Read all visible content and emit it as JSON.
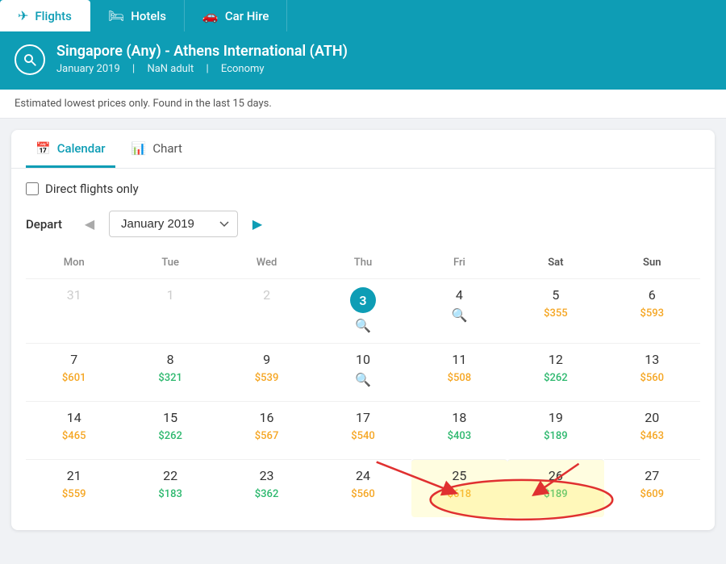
{
  "tabs": [
    {
      "id": "flights",
      "label": "Flights",
      "icon": "✈",
      "active": true
    },
    {
      "id": "hotels",
      "label": "Hotels",
      "icon": "🛏",
      "active": false
    },
    {
      "id": "carhire",
      "label": "Car Hire",
      "icon": "🚗",
      "active": false
    }
  ],
  "search": {
    "route": "Singapore (Any) - Athens International (ATH)",
    "month": "January 2019",
    "adults": "NaN adult",
    "class": "Economy"
  },
  "notice": "Estimated lowest prices only. Found in the last 15 days.",
  "view_tabs": [
    {
      "id": "calendar",
      "label": "Calendar",
      "icon": "📅",
      "active": true
    },
    {
      "id": "chart",
      "label": "Chart",
      "icon": "📊",
      "active": false
    }
  ],
  "calendar": {
    "direct_flights_label": "Direct flights only",
    "depart_label": "Depart",
    "month_display": "January 2019",
    "day_headers": [
      "Mon",
      "Tue",
      "Wed",
      "Thu",
      "Fri",
      "Sat",
      "Sun"
    ],
    "weeks": [
      [
        {
          "num": "31",
          "empty": true,
          "price": "",
          "price_color": ""
        },
        {
          "num": "1",
          "empty": true,
          "price": "",
          "price_color": ""
        },
        {
          "num": "2",
          "empty": true,
          "price": "",
          "price_color": ""
        },
        {
          "num": "3",
          "today": true,
          "price": "",
          "price_color": "",
          "search": true
        },
        {
          "num": "4",
          "price": "",
          "price_color": "",
          "search": true
        },
        {
          "num": "5",
          "price": "$355",
          "price_color": "orange"
        },
        {
          "num": "6",
          "price": "$593",
          "price_color": "orange"
        }
      ],
      [
        {
          "num": "7",
          "price": "$601",
          "price_color": "orange"
        },
        {
          "num": "8",
          "price": "$321",
          "price_color": "green"
        },
        {
          "num": "9",
          "price": "$539",
          "price_color": "orange"
        },
        {
          "num": "10",
          "price": "",
          "price_color": "",
          "search": true
        },
        {
          "num": "11",
          "price": "$508",
          "price_color": "orange"
        },
        {
          "num": "12",
          "price": "$262",
          "price_color": "green"
        },
        {
          "num": "13",
          "price": "$560",
          "price_color": "orange"
        }
      ],
      [
        {
          "num": "14",
          "price": "$465",
          "price_color": "orange"
        },
        {
          "num": "15",
          "price": "$262",
          "price_color": "green"
        },
        {
          "num": "16",
          "price": "$567",
          "price_color": "orange"
        },
        {
          "num": "17",
          "price": "$540",
          "price_color": "orange"
        },
        {
          "num": "18",
          "price": "$403",
          "price_color": "green"
        },
        {
          "num": "19",
          "price": "$189",
          "price_color": "green"
        },
        {
          "num": "20",
          "price": "$463",
          "price_color": "orange"
        }
      ],
      [
        {
          "num": "21",
          "price": "$559",
          "price_color": "orange"
        },
        {
          "num": "22",
          "price": "$183",
          "price_color": "green"
        },
        {
          "num": "23",
          "price": "$362",
          "price_color": "green"
        },
        {
          "num": "24",
          "price": "$560",
          "price_color": "orange"
        },
        {
          "num": "25",
          "price": "$618",
          "price_color": "orange",
          "highlight": true
        },
        {
          "num": "26",
          "price": "$189",
          "price_color": "green",
          "highlight": true
        },
        {
          "num": "27",
          "price": "$609",
          "price_color": "orange"
        }
      ]
    ]
  }
}
